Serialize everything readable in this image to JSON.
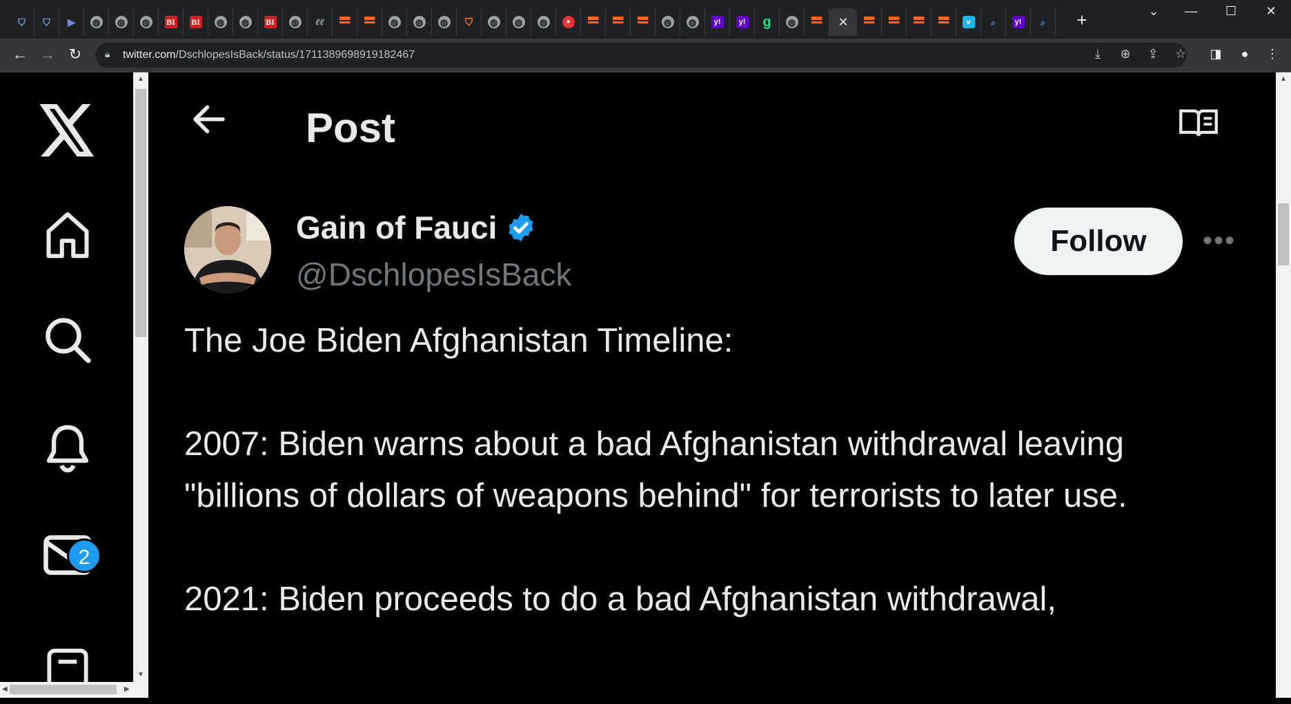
{
  "browser": {
    "url_host": "twitter.com",
    "url_path": "/DschlopesIsBack/status/1711389698919182467",
    "tabs": [
      {
        "icon": "shield-icon"
      },
      {
        "icon": "shield-icon"
      },
      {
        "icon": "bookmark-icon"
      },
      {
        "icon": "globe-icon"
      },
      {
        "icon": "globe-icon"
      },
      {
        "icon": "globe-icon"
      },
      {
        "icon": "bi-icon",
        "text": "BI"
      },
      {
        "icon": "bi-icon",
        "text": "BI"
      },
      {
        "icon": "globe-icon"
      },
      {
        "icon": "globe-icon"
      },
      {
        "icon": "bi-icon",
        "text": "BI"
      },
      {
        "icon": "globe-icon"
      },
      {
        "icon": "ab-icon",
        "text": "ℓℓ"
      },
      {
        "icon": "substack-icon"
      },
      {
        "icon": "substack-icon"
      },
      {
        "icon": "globe-icon"
      },
      {
        "icon": "globe-icon"
      },
      {
        "icon": "globe-icon"
      },
      {
        "icon": "shield-orange-icon"
      },
      {
        "icon": "globe-icon"
      },
      {
        "icon": "globe-icon"
      },
      {
        "icon": "globe-icon"
      },
      {
        "icon": "mic-icon"
      },
      {
        "icon": "substack-icon"
      },
      {
        "icon": "substack-icon"
      },
      {
        "icon": "substack-icon"
      },
      {
        "icon": "globe-icon"
      },
      {
        "icon": "globe-icon"
      },
      {
        "icon": "yahoo-icon",
        "text": "y!"
      },
      {
        "icon": "yahoo-icon",
        "text": "y!"
      },
      {
        "icon": "green-g-icon",
        "text": "g"
      },
      {
        "icon": "globe-icon"
      },
      {
        "icon": "substack-icon"
      },
      {
        "icon": "close-icon",
        "active": true
      },
      {
        "icon": "substack-icon"
      },
      {
        "icon": "substack-icon"
      },
      {
        "icon": "substack-icon"
      },
      {
        "icon": "substack-icon"
      },
      {
        "icon": "vimeo-icon",
        "text": "v"
      },
      {
        "icon": "search-icon"
      },
      {
        "icon": "yahoo-icon",
        "text": "y!"
      },
      {
        "icon": "search-icon"
      }
    ]
  },
  "page": {
    "header_title": "Post",
    "author": {
      "name": "Gain of Fauci",
      "handle": "@DschlopesIsBack",
      "verified": true
    },
    "follow_label": "Follow",
    "messages_badge": "2",
    "tweet_lines": [
      "The Joe Biden Afghanistan Timeline:",
      "",
      "2007: Biden warns about a bad Afghanistan withdrawal leaving \"billions of dollars of weapons behind\" for terrorists to later use.",
      "",
      "2021: Biden proceeds to do a bad Afghanistan withdrawal,"
    ]
  }
}
